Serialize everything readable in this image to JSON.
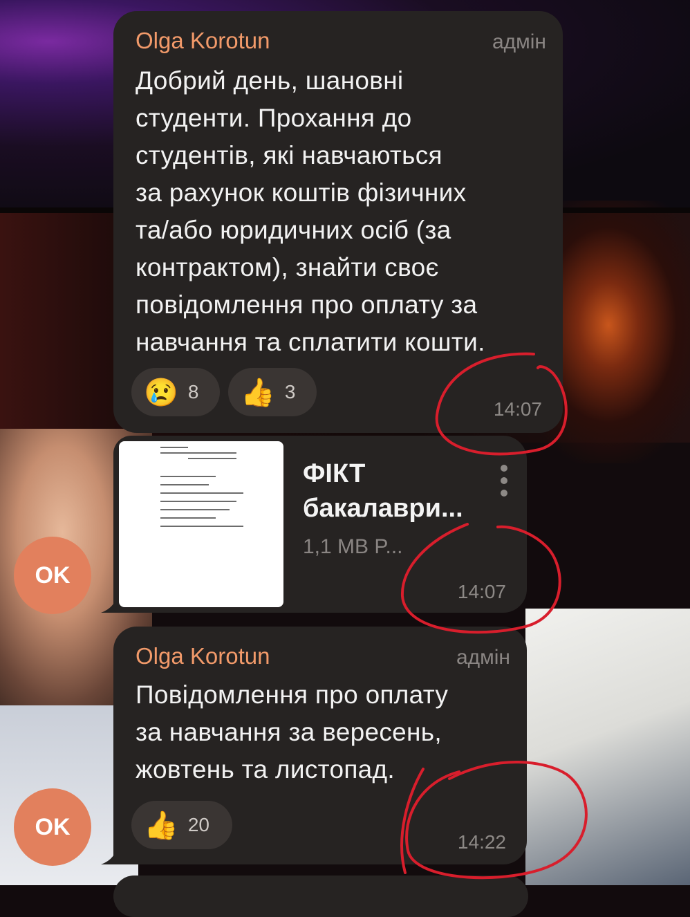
{
  "messages": [
    {
      "sender": "Olga Korotun",
      "role": "адмін",
      "lines": [
        "Добрий день, шановні",
        "студенти. Прохання до",
        "студентів, які навчаються",
        "за рахунок коштів фізичних",
        "та/або юридичних осіб (за",
        "контрактом), знайти своє",
        "повідомлення про оплату за",
        "навчання та сплатити кошти."
      ],
      "reactions": [
        {
          "emoji": "😢",
          "count": "8"
        },
        {
          "emoji": "👍",
          "count": "3"
        }
      ],
      "time": "14:07"
    },
    {
      "file_name_lines": [
        "ФІКТ",
        "бакалаври..."
      ],
      "file_meta": "1,1 MB P...",
      "time": "14:07",
      "avatar": "OK"
    },
    {
      "sender": "Olga Korotun",
      "role": "адмін",
      "lines": [
        "Повідомлення про оплату",
        "за навчання за вересень,",
        "жовтень та листопад."
      ],
      "reactions": [
        {
          "emoji": "👍",
          "count": "20"
        }
      ],
      "time": "14:22",
      "avatar": "OK"
    }
  ],
  "colors": {
    "bubble": "#262322",
    "sender": "#f29a6a",
    "avatar": "#e2805d",
    "annotation": "#d81e2c"
  }
}
